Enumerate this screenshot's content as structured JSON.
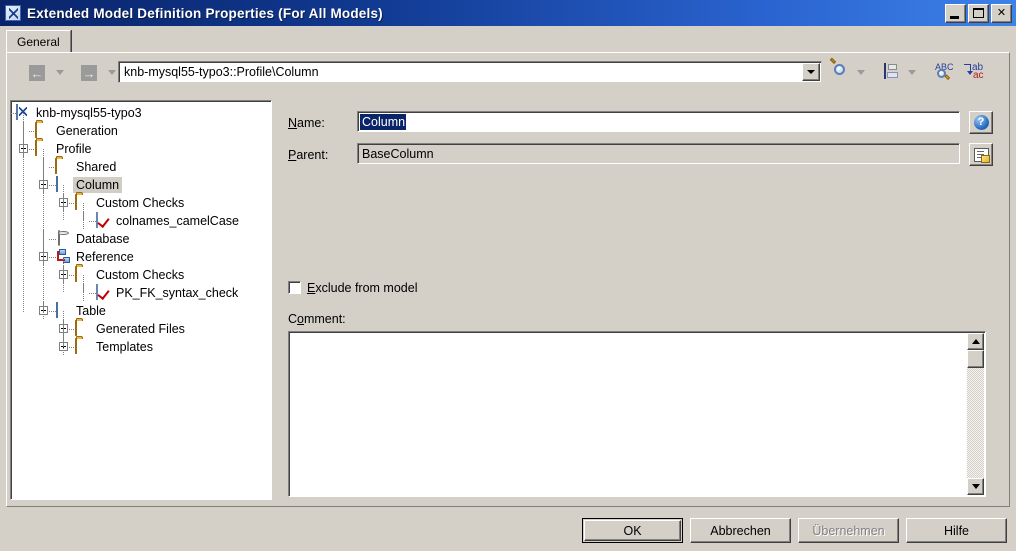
{
  "window": {
    "title": "Extended Model Definition Properties (For All Models)",
    "icon": "model-document-icon",
    "minimize_label": "Minimize",
    "maximize_label": "Maximize",
    "close_label": "Close"
  },
  "tabs": [
    {
      "label": "General",
      "selected": true
    }
  ],
  "toolbar": {
    "back_label": "Back",
    "back_dropdown_label": "Back history",
    "forward_label": "Forward",
    "forward_dropdown_label": "Forward history",
    "address_value": "knb-mysql55-typo3::Profile\\Column",
    "address_dropdown_label": "Address history",
    "icons": [
      {
        "name": "find-icon",
        "label": "Find"
      },
      {
        "name": "find-dropdown-icon",
        "label": "Find options"
      },
      {
        "name": "save-icon",
        "label": "Save"
      },
      {
        "name": "save-dropdown-icon",
        "label": "Save options"
      },
      {
        "name": "spellcheck-icon",
        "label": "Check spelling"
      },
      {
        "name": "sort-icon",
        "label": "Sort"
      }
    ]
  },
  "tree": {
    "nodes": [
      {
        "label": "knb-mysql55-typo3",
        "icon": "model-document-icon",
        "depth": 0,
        "expander": "none",
        "selected": false
      },
      {
        "label": "Generation",
        "icon": "folder-icon",
        "depth": 1,
        "expander": "none",
        "selected": false
      },
      {
        "label": "Profile",
        "icon": "folder-icon",
        "depth": 1,
        "expander": "minus",
        "selected": false
      },
      {
        "label": "Shared",
        "icon": "folder-icon",
        "depth": 2,
        "expander": "none",
        "selected": false
      },
      {
        "label": "Column",
        "icon": "column-grid-icon",
        "depth": 2,
        "expander": "minus",
        "selected": true
      },
      {
        "label": "Custom Checks",
        "icon": "folder-icon",
        "depth": 3,
        "expander": "minus",
        "selected": false
      },
      {
        "label": "colnames_camelCase",
        "icon": "check-script-icon",
        "depth": 4,
        "expander": "none",
        "selected": false
      },
      {
        "label": "Database",
        "icon": "database-icon",
        "depth": 2,
        "expander": "none",
        "selected": false
      },
      {
        "label": "Reference",
        "icon": "reference-icon",
        "depth": 2,
        "expander": "minus",
        "selected": false
      },
      {
        "label": "Custom Checks",
        "icon": "folder-icon",
        "depth": 3,
        "expander": "minus",
        "selected": false
      },
      {
        "label": "PK_FK_syntax_check",
        "icon": "check-script-icon",
        "depth": 4,
        "expander": "none",
        "selected": false
      },
      {
        "label": "Table",
        "icon": "table-icon",
        "depth": 2,
        "expander": "minus",
        "selected": false
      },
      {
        "label": "Generated Files",
        "icon": "folder-icon",
        "depth": 3,
        "expander": "plus",
        "selected": false
      },
      {
        "label": "Templates",
        "icon": "folder-icon",
        "depth": 3,
        "expander": "plus",
        "selected": false
      }
    ]
  },
  "details": {
    "name_label": "Name:",
    "name_accel": "N",
    "name_value": "Column",
    "name_help_label": "?",
    "parent_label": "Parent:",
    "parent_accel": "P",
    "parent_value": "BaseColumn",
    "parent_button_label": "Properties",
    "exclude_label": "Exclude from model",
    "exclude_accel": "E",
    "exclude_checked": false,
    "comment_label": "Comment:",
    "comment_accel": "o",
    "comment_value": ""
  },
  "footer": {
    "buttons": [
      {
        "label": "OK",
        "name": "ok-button",
        "state": "default"
      },
      {
        "label": "Abbrechen",
        "name": "cancel-button",
        "state": "normal"
      },
      {
        "label": "Übernehmen",
        "name": "apply-button",
        "state": "disabled",
        "accel": "b"
      },
      {
        "label": "Hilfe",
        "name": "help-button",
        "state": "normal"
      }
    ]
  },
  "colors": {
    "titlebar_start": "#0a246a",
    "titlebar_end": "#3d82e8",
    "face": "#d4d0c8",
    "selection": "#0a246a",
    "tree_selection": "#d0cdc4"
  }
}
